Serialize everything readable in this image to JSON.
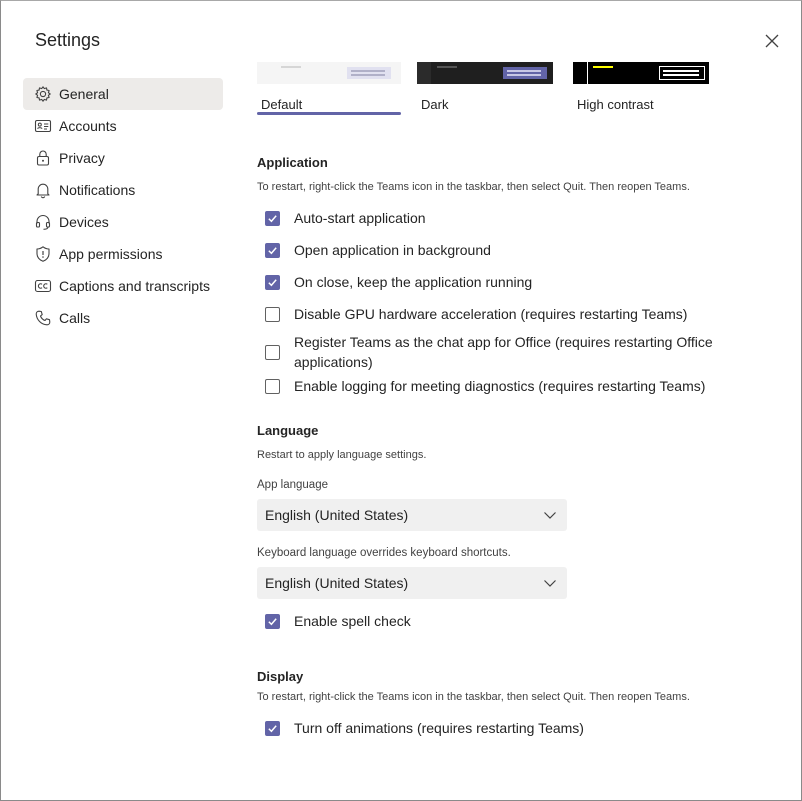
{
  "window": {
    "title": "Settings"
  },
  "colors": {
    "accent": "#6264a7",
    "active_bg": "#edebe9",
    "select_bg": "#f0f0f0"
  },
  "sidebar": {
    "items": [
      {
        "label": "General",
        "icon": "gear-icon",
        "active": true
      },
      {
        "label": "Accounts",
        "icon": "id-card-icon"
      },
      {
        "label": "Privacy",
        "icon": "lock-icon"
      },
      {
        "label": "Notifications",
        "icon": "bell-icon"
      },
      {
        "label": "Devices",
        "icon": "headset-icon"
      },
      {
        "label": "App permissions",
        "icon": "shield-icon"
      },
      {
        "label": "Captions and transcripts",
        "icon": "closed-captions-icon"
      },
      {
        "label": "Calls",
        "icon": "phone-icon"
      }
    ]
  },
  "themes": [
    {
      "label": "Default",
      "selected": true
    },
    {
      "label": "Dark"
    },
    {
      "label": "High contrast"
    }
  ],
  "application": {
    "title": "Application",
    "desc": "To restart, right-click the Teams icon in the taskbar, then select Quit. Then reopen Teams.",
    "options": [
      {
        "label": "Auto-start application",
        "checked": true
      },
      {
        "label": "Open application in background",
        "checked": true
      },
      {
        "label": "On close, keep the application running",
        "checked": true
      },
      {
        "label": "Disable GPU hardware acceleration (requires restarting Teams)",
        "checked": false
      },
      {
        "label": "Register Teams as the chat app for Office (requires restarting Office applications)",
        "checked": false
      },
      {
        "label": "Enable logging for meeting diagnostics (requires restarting Teams)",
        "checked": false
      }
    ]
  },
  "language": {
    "title": "Language",
    "desc": "Restart to apply language settings.",
    "app_language_label": "App language",
    "app_language_value": "English (United States)",
    "keyboard_label": "Keyboard language overrides keyboard shortcuts.",
    "keyboard_value": "English (United States)",
    "spell_check_label": "Enable spell check",
    "spell_check_checked": true
  },
  "display": {
    "title": "Display",
    "desc": "To restart, right-click the Teams icon in the taskbar, then select Quit. Then reopen Teams.",
    "animations_label": "Turn off animations (requires restarting Teams)",
    "animations_checked": true
  }
}
